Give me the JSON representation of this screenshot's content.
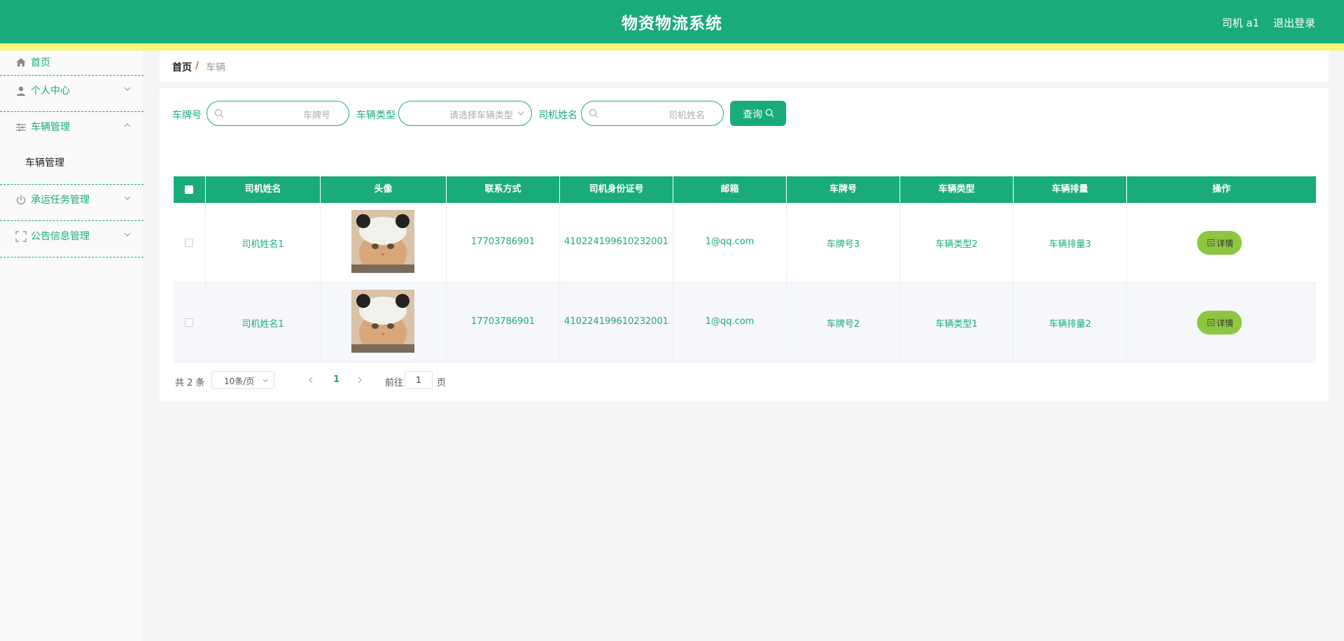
{
  "header": {
    "title": "物资物流系统",
    "user": "司机 a1",
    "logout": "退出登录"
  },
  "sidebar": {
    "items": [
      {
        "label": "首页",
        "icon": "home-icon"
      },
      {
        "label": "个人中心",
        "icon": "user-icon"
      },
      {
        "label": "车辆管理",
        "icon": "sliders-icon",
        "children": [
          "车辆管理"
        ]
      },
      {
        "label": "承运任务管理",
        "icon": "power-icon"
      },
      {
        "label": "公告信息管理",
        "icon": "fullscreen-icon"
      }
    ]
  },
  "breadcrumb": {
    "home": "首页",
    "separator": "/",
    "current": "车辆"
  },
  "search": {
    "plate_label": "车牌号",
    "plate_placeholder": "车牌号",
    "type_label": "车辆类型",
    "type_placeholder": "请选择车辆类型",
    "driver_label": "司机姓名",
    "driver_placeholder": "司机姓名",
    "query_button": "查询"
  },
  "table": {
    "columns": [
      "司机姓名",
      "头像",
      "联系方式",
      "司机身份证号",
      "邮箱",
      "车牌号",
      "车辆类型",
      "车辆排量",
      "操作"
    ],
    "rows": [
      {
        "driver": "司机姓名1",
        "phone": "17703786901",
        "id_card": "410224199610232001",
        "email": "1@qq.com",
        "plate": "车牌号3",
        "type": "车辆类型2",
        "displacement": "车辆排量3",
        "action": "详情"
      },
      {
        "driver": "司机姓名1",
        "phone": "17703786901",
        "id_card": "410224199610232001",
        "email": "1@qq.com",
        "plate": "车牌号2",
        "type": "车辆类型1",
        "displacement": "车辆排量2",
        "action": "详情"
      }
    ]
  },
  "pagination": {
    "total": "共 2 条",
    "page_size": "10条/页",
    "current_page": "1",
    "goto_label": "前往",
    "goto_value": "1",
    "page_suffix": "页"
  },
  "colors": {
    "primary": "#1aab7b",
    "header_stripe": "#f6f571",
    "detail_button": "#8dc63f"
  }
}
